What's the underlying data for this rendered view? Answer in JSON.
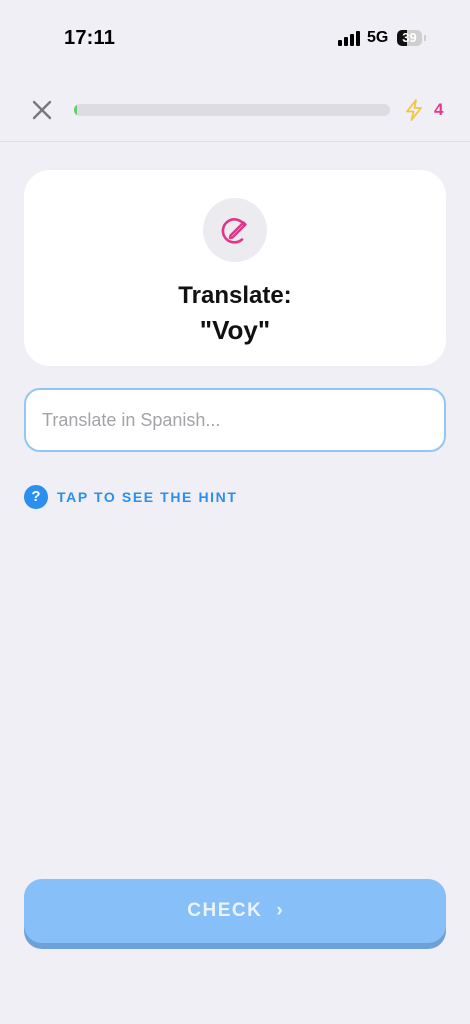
{
  "status_bar": {
    "time": "17:11",
    "network": "5G",
    "battery": "39",
    "battery_level": 0.39
  },
  "header": {
    "progress": 0.01,
    "progress_color": "#5fd068",
    "energy_icon": "lightning-icon",
    "energy_count": "4"
  },
  "prompt": {
    "icon": "pencil-circle-icon",
    "title": "Translate:",
    "word": "\"Voy\""
  },
  "answer": {
    "value": "",
    "placeholder": "Translate in Spanish..."
  },
  "hint": {
    "icon": "question-icon",
    "label": "TAP TO SEE THE HINT"
  },
  "footer": {
    "check_label": "CHECK",
    "check_icon": "chevron-right-icon"
  },
  "colors": {
    "background": "#efeff5",
    "accent_blue": "#2b8ff0",
    "check_button": "#87bff8",
    "pink_accent": "#e8388a",
    "energy_yellow": "#f5c542"
  }
}
